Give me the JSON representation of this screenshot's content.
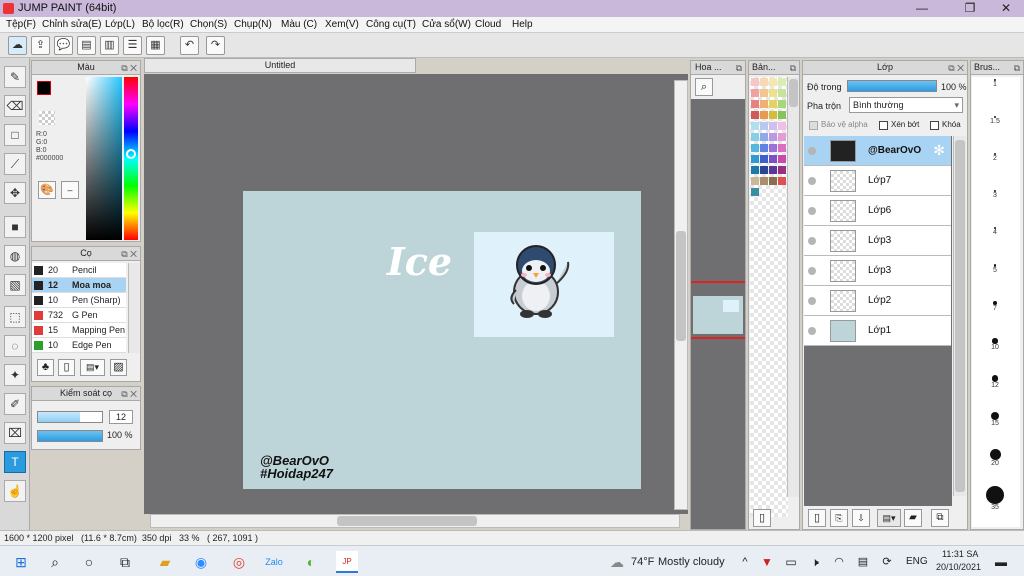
{
  "window": {
    "title": "JUMP PAINT (64bit)",
    "controls": [
      "—",
      "❐",
      "✕"
    ]
  },
  "menu": [
    "Tệp(F)",
    "Chỉnh sửa(E)",
    "Lớp(L)",
    "Bộ lọc(R)",
    "Chọn(S)",
    "Chụp(N)",
    "Màu (C)",
    "Xem(V)",
    "Công cụ(T)",
    "Cửa sổ(W)",
    "Cloud",
    "Help"
  ],
  "document": {
    "tab_title": "Untitled"
  },
  "canvas": {
    "ice_text": "Ice",
    "watermark_line1": "@BearOvO",
    "watermark_line2": "#Hoidap247",
    "bg_color": "#bdd5d8",
    "box_color": "#dff1fb"
  },
  "color_panel": {
    "title": "Màu",
    "r": "R:0",
    "g": "G:0",
    "b": "B:0",
    "hex": "#000000"
  },
  "brush_panel": {
    "title": "Cọ",
    "items": [
      {
        "size": "20",
        "name": "Pencil",
        "color": "#222222"
      },
      {
        "size": "12",
        "name": "Moa moa",
        "color": "#222222"
      },
      {
        "size": "10",
        "name": "Pen (Sharp)",
        "color": "#222222"
      },
      {
        "size": "732",
        "name": "G Pen",
        "color": "#e03a3a"
      },
      {
        "size": "15",
        "name": "Mapping Pen",
        "color": "#e03a3a"
      },
      {
        "size": "10",
        "name": "Edge Pen",
        "color": "#2aa12a"
      }
    ]
  },
  "brush_control": {
    "title": "Kiểm soát cọ",
    "size_value": "12",
    "opacity_value": "100 %",
    "size_level": 0.66,
    "opacity_level": 1.0
  },
  "navigator": {
    "title": "Hoa ..."
  },
  "palette": {
    "title": "Bản...",
    "colors": [
      "#f7c6c6",
      "#f8d9b4",
      "#f6e7b0",
      "#d9eeb5",
      "#c6e7cd",
      "#f2a1a1",
      "#f4c58f",
      "#efe08b",
      "#c5e59b",
      "#a9dcb8",
      "#e88080",
      "#f0b070",
      "#e5d35f",
      "#a7d67c",
      "#7fc99b",
      "#d05a5a",
      "#e89a50",
      "#d3bd3a",
      "#86c35a",
      "#52b27e",
      "#b0e0f0",
      "#b8c8f0",
      "#d2bff0",
      "#f0c0e6",
      "#f5f5f5",
      "#86cfe9",
      "#8fa9ec",
      "#b89ae9",
      "#e79bd6",
      "#dddddd",
      "#55b8df",
      "#5f83e3",
      "#9a72df",
      "#dc6fc4",
      "#bbbbbb",
      "#2f9ad0",
      "#3b5fcf",
      "#7a4fcc",
      "#c94aaa",
      "#888888",
      "#1b7aa8",
      "#2b4596",
      "#5a389a",
      "#9a2f7f",
      "#555555",
      "#c9b89a",
      "#a98f6e",
      "#8a6f4e",
      "#e05050",
      "#222222",
      "#3a8ea0"
    ]
  },
  "layers_panel": {
    "title": "Lớp",
    "opacity_label": "Độ trong",
    "opacity_value": "100 %",
    "blend_label": "Pha trộn",
    "blend_value": "Bình thường",
    "protect_alpha": "Bảo vệ alpha",
    "clip": "Xén bớt",
    "lock": "Khóa",
    "layers": [
      {
        "name": "@BearOvO",
        "selected": true
      },
      {
        "name": "Lớp7",
        "selected": false
      },
      {
        "name": "Lớp6",
        "selected": false
      },
      {
        "name": "Lớp3",
        "selected": false
      },
      {
        "name": "Lớp3",
        "selected": false
      },
      {
        "name": "Lớp2",
        "selected": false
      },
      {
        "name": "Lớp1",
        "selected": false
      }
    ]
  },
  "brush_sizes_panel": {
    "title": "Brus...",
    "sizes": [
      "1",
      "1.5",
      "2",
      "3",
      "4",
      "5",
      "7",
      "10",
      "12",
      "15",
      "20",
      "35"
    ]
  },
  "status": {
    "text": "1600 * 1200 pixel   (11.6 * 8.7cm)  350 dpi   33 %   ( 267, 1091 )"
  },
  "taskbar": {
    "weather_temp": "74°F",
    "weather_text": "Mostly cloudy",
    "lang": "ENG",
    "time": "11:31 SA",
    "date": "20/10/2021"
  }
}
